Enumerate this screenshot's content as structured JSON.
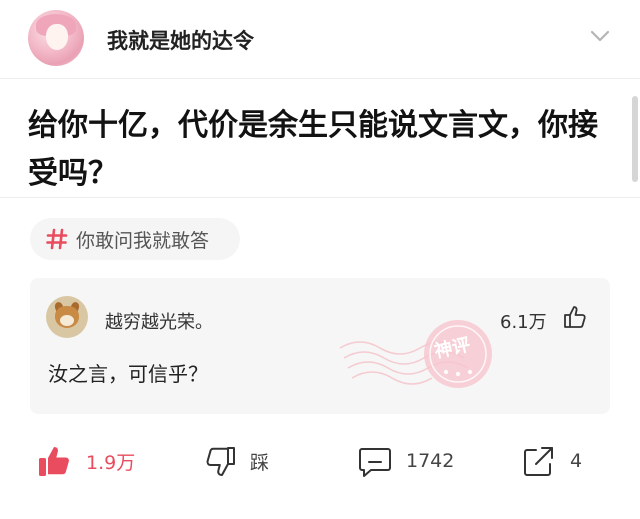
{
  "header": {
    "author_name": "我就是她的达令",
    "avatar_icon": "anime-girl-avatar-icon",
    "chevron_icon": "chevron-down-icon"
  },
  "question": {
    "title": "给你十亿，代价是余生只能说文言文，你接受吗？"
  },
  "topic": {
    "icon": "hashtag-icon",
    "label": "你敢问我就敢答",
    "accent": "#e94c5f"
  },
  "comment": {
    "username": "越穷越光荣。",
    "likes": "6.1万",
    "text": "汝之言，可信乎？",
    "avatar_icon": "shiba-dog-avatar-icon",
    "like_icon": "thumbs-up-icon",
    "badge": {
      "text": "神评",
      "color": "#f0a7b3"
    }
  },
  "actions": {
    "like": {
      "icon": "thumbs-up-filled-icon",
      "label": "1.9万",
      "color": "#e94c5f"
    },
    "dislike": {
      "icon": "thumbs-down-icon",
      "label": "踩"
    },
    "comment": {
      "icon": "comment-bubble-icon",
      "label": "1742"
    },
    "share": {
      "icon": "share-icon",
      "label": "4"
    }
  }
}
